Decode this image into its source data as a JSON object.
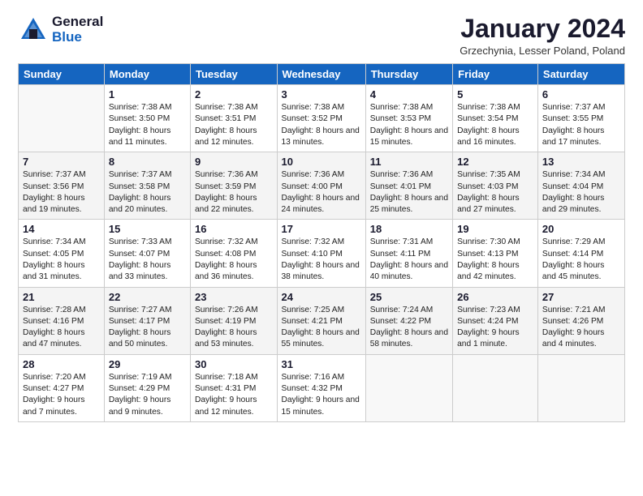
{
  "header": {
    "logo_general": "General",
    "logo_blue": "Blue",
    "month_title": "January 2024",
    "location": "Grzechynia, Lesser Poland, Poland"
  },
  "weekdays": [
    "Sunday",
    "Monday",
    "Tuesday",
    "Wednesday",
    "Thursday",
    "Friday",
    "Saturday"
  ],
  "weeks": [
    [
      {
        "day": "",
        "sunrise": "",
        "sunset": "",
        "daylight": ""
      },
      {
        "day": "1",
        "sunrise": "Sunrise: 7:38 AM",
        "sunset": "Sunset: 3:50 PM",
        "daylight": "Daylight: 8 hours and 11 minutes."
      },
      {
        "day": "2",
        "sunrise": "Sunrise: 7:38 AM",
        "sunset": "Sunset: 3:51 PM",
        "daylight": "Daylight: 8 hours and 12 minutes."
      },
      {
        "day": "3",
        "sunrise": "Sunrise: 7:38 AM",
        "sunset": "Sunset: 3:52 PM",
        "daylight": "Daylight: 8 hours and 13 minutes."
      },
      {
        "day": "4",
        "sunrise": "Sunrise: 7:38 AM",
        "sunset": "Sunset: 3:53 PM",
        "daylight": "Daylight: 8 hours and 15 minutes."
      },
      {
        "day": "5",
        "sunrise": "Sunrise: 7:38 AM",
        "sunset": "Sunset: 3:54 PM",
        "daylight": "Daylight: 8 hours and 16 minutes."
      },
      {
        "day": "6",
        "sunrise": "Sunrise: 7:37 AM",
        "sunset": "Sunset: 3:55 PM",
        "daylight": "Daylight: 8 hours and 17 minutes."
      }
    ],
    [
      {
        "day": "7",
        "sunrise": "Sunrise: 7:37 AM",
        "sunset": "Sunset: 3:56 PM",
        "daylight": "Daylight: 8 hours and 19 minutes."
      },
      {
        "day": "8",
        "sunrise": "Sunrise: 7:37 AM",
        "sunset": "Sunset: 3:58 PM",
        "daylight": "Daylight: 8 hours and 20 minutes."
      },
      {
        "day": "9",
        "sunrise": "Sunrise: 7:36 AM",
        "sunset": "Sunset: 3:59 PM",
        "daylight": "Daylight: 8 hours and 22 minutes."
      },
      {
        "day": "10",
        "sunrise": "Sunrise: 7:36 AM",
        "sunset": "Sunset: 4:00 PM",
        "daylight": "Daylight: 8 hours and 24 minutes."
      },
      {
        "day": "11",
        "sunrise": "Sunrise: 7:36 AM",
        "sunset": "Sunset: 4:01 PM",
        "daylight": "Daylight: 8 hours and 25 minutes."
      },
      {
        "day": "12",
        "sunrise": "Sunrise: 7:35 AM",
        "sunset": "Sunset: 4:03 PM",
        "daylight": "Daylight: 8 hours and 27 minutes."
      },
      {
        "day": "13",
        "sunrise": "Sunrise: 7:34 AM",
        "sunset": "Sunset: 4:04 PM",
        "daylight": "Daylight: 8 hours and 29 minutes."
      }
    ],
    [
      {
        "day": "14",
        "sunrise": "Sunrise: 7:34 AM",
        "sunset": "Sunset: 4:05 PM",
        "daylight": "Daylight: 8 hours and 31 minutes."
      },
      {
        "day": "15",
        "sunrise": "Sunrise: 7:33 AM",
        "sunset": "Sunset: 4:07 PM",
        "daylight": "Daylight: 8 hours and 33 minutes."
      },
      {
        "day": "16",
        "sunrise": "Sunrise: 7:32 AM",
        "sunset": "Sunset: 4:08 PM",
        "daylight": "Daylight: 8 hours and 36 minutes."
      },
      {
        "day": "17",
        "sunrise": "Sunrise: 7:32 AM",
        "sunset": "Sunset: 4:10 PM",
        "daylight": "Daylight: 8 hours and 38 minutes."
      },
      {
        "day": "18",
        "sunrise": "Sunrise: 7:31 AM",
        "sunset": "Sunset: 4:11 PM",
        "daylight": "Daylight: 8 hours and 40 minutes."
      },
      {
        "day": "19",
        "sunrise": "Sunrise: 7:30 AM",
        "sunset": "Sunset: 4:13 PM",
        "daylight": "Daylight: 8 hours and 42 minutes."
      },
      {
        "day": "20",
        "sunrise": "Sunrise: 7:29 AM",
        "sunset": "Sunset: 4:14 PM",
        "daylight": "Daylight: 8 hours and 45 minutes."
      }
    ],
    [
      {
        "day": "21",
        "sunrise": "Sunrise: 7:28 AM",
        "sunset": "Sunset: 4:16 PM",
        "daylight": "Daylight: 8 hours and 47 minutes."
      },
      {
        "day": "22",
        "sunrise": "Sunrise: 7:27 AM",
        "sunset": "Sunset: 4:17 PM",
        "daylight": "Daylight: 8 hours and 50 minutes."
      },
      {
        "day": "23",
        "sunrise": "Sunrise: 7:26 AM",
        "sunset": "Sunset: 4:19 PM",
        "daylight": "Daylight: 8 hours and 53 minutes."
      },
      {
        "day": "24",
        "sunrise": "Sunrise: 7:25 AM",
        "sunset": "Sunset: 4:21 PM",
        "daylight": "Daylight: 8 hours and 55 minutes."
      },
      {
        "day": "25",
        "sunrise": "Sunrise: 7:24 AM",
        "sunset": "Sunset: 4:22 PM",
        "daylight": "Daylight: 8 hours and 58 minutes."
      },
      {
        "day": "26",
        "sunrise": "Sunrise: 7:23 AM",
        "sunset": "Sunset: 4:24 PM",
        "daylight": "Daylight: 9 hours and 1 minute."
      },
      {
        "day": "27",
        "sunrise": "Sunrise: 7:21 AM",
        "sunset": "Sunset: 4:26 PM",
        "daylight": "Daylight: 9 hours and 4 minutes."
      }
    ],
    [
      {
        "day": "28",
        "sunrise": "Sunrise: 7:20 AM",
        "sunset": "Sunset: 4:27 PM",
        "daylight": "Daylight: 9 hours and 7 minutes."
      },
      {
        "day": "29",
        "sunrise": "Sunrise: 7:19 AM",
        "sunset": "Sunset: 4:29 PM",
        "daylight": "Daylight: 9 hours and 9 minutes."
      },
      {
        "day": "30",
        "sunrise": "Sunrise: 7:18 AM",
        "sunset": "Sunset: 4:31 PM",
        "daylight": "Daylight: 9 hours and 12 minutes."
      },
      {
        "day": "31",
        "sunrise": "Sunrise: 7:16 AM",
        "sunset": "Sunset: 4:32 PM",
        "daylight": "Daylight: 9 hours and 15 minutes."
      },
      {
        "day": "",
        "sunrise": "",
        "sunset": "",
        "daylight": ""
      },
      {
        "day": "",
        "sunrise": "",
        "sunset": "",
        "daylight": ""
      },
      {
        "day": "",
        "sunrise": "",
        "sunset": "",
        "daylight": ""
      }
    ]
  ]
}
